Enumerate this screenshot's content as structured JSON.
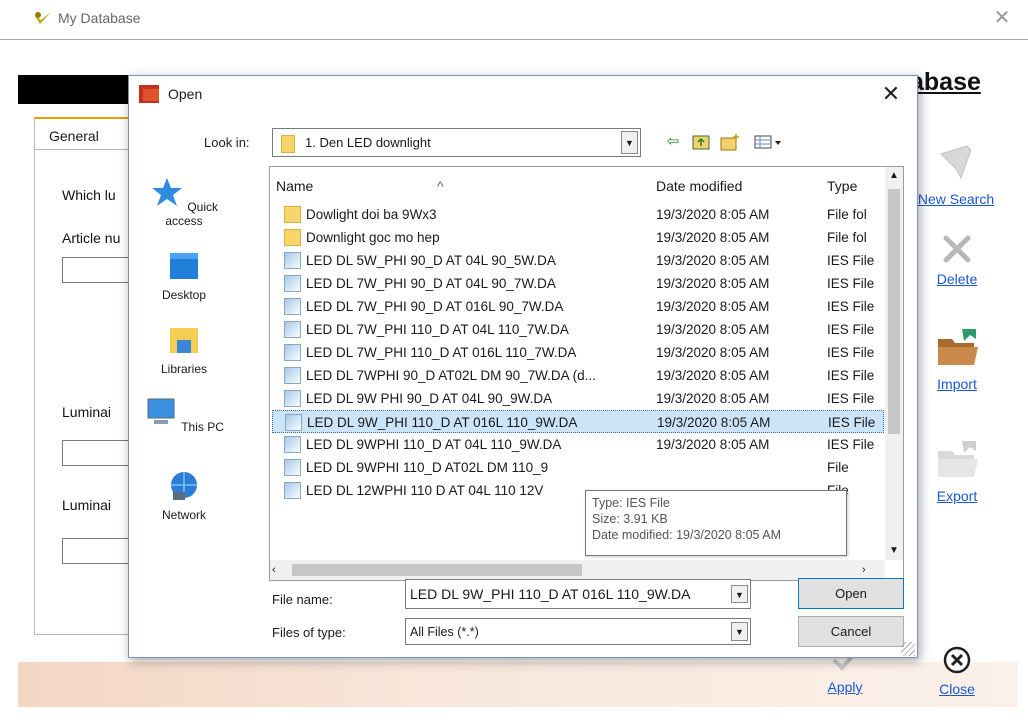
{
  "app": {
    "title": "My Database",
    "header_title": "abase",
    "general_tab": "General",
    "labels": {
      "which": "Which lu",
      "article": "Article nu",
      "luminai1": "Luminai",
      "luminai2": "Luminai"
    },
    "side_buttons": {
      "new_search": "New Search",
      "delete": "Delete",
      "import": "Import",
      "export": "Export",
      "apply": "Apply",
      "close": "Close"
    }
  },
  "dialog": {
    "title": "Open",
    "look_in_label": "Look in:",
    "look_in_value": "1. Den LED downlight",
    "places": [
      "Quick access",
      "Desktop",
      "Libraries",
      "This PC",
      "Network"
    ],
    "columns": {
      "name": "Name",
      "date": "Date modified",
      "type": "Type"
    },
    "files": [
      {
        "name": "Dowlight doi ba  9Wx3",
        "date": "19/3/2020 8:05 AM",
        "type": "File fol",
        "kind": "folder"
      },
      {
        "name": "Downlight goc mo hep",
        "date": "19/3/2020 8:05 AM",
        "type": "File fol",
        "kind": "folder"
      },
      {
        "name": "LED DL 5W_PHI 90_D AT 04L 90_5W.DA",
        "date": "19/3/2020 8:05 AM",
        "type": "IES File",
        "kind": "file"
      },
      {
        "name": "LED DL 7W_PHI 90_D AT 04L 90_7W.DA",
        "date": "19/3/2020 8:05 AM",
        "type": "IES File",
        "kind": "file"
      },
      {
        "name": "LED DL 7W_PHI 90_D AT 016L 90_7W.DA",
        "date": "19/3/2020 8:05 AM",
        "type": "IES File",
        "kind": "file"
      },
      {
        "name": "LED DL 7W_PHI 110_D AT 04L 110_7W.DA",
        "date": "19/3/2020 8:05 AM",
        "type": "IES File",
        "kind": "file"
      },
      {
        "name": "LED DL 7W_PHI 110_D AT 016L 110_7W.DA",
        "date": "19/3/2020 8:05 AM",
        "type": "IES File",
        "kind": "file"
      },
      {
        "name": "LED DL 7WPHI 90_D AT02L DM 90_7W.DA (d...",
        "date": "19/3/2020 8:05 AM",
        "type": "IES File",
        "kind": "file"
      },
      {
        "name": "LED DL 9W PHI 90_D AT 04L 90_9W.DA",
        "date": "19/3/2020 8:05 AM",
        "type": "IES File",
        "kind": "file"
      },
      {
        "name": "LED DL 9W_PHI 110_D AT 016L 110_9W.DA",
        "date": "19/3/2020 8:05 AM",
        "type": "IES File",
        "kind": "file",
        "selected": true
      },
      {
        "name": "LED DL 9WPHI 110_D AT 04L 110_9W.DA",
        "date": "19/3/2020 8:05 AM",
        "type": "IES File",
        "kind": "file"
      },
      {
        "name": "LED DL 9WPHI 110_D AT02L DM 110_9",
        "date": "",
        "type": "File",
        "kind": "file"
      },
      {
        "name": "LED DL 12WPHI 110  D AT 04L 110  12V",
        "date": "",
        "type": "File",
        "kind": "file"
      }
    ],
    "tooltip": {
      "type": "Type: IES File",
      "size": "Size: 3.91 KB",
      "date": "Date modified: 19/3/2020 8:05 AM"
    },
    "file_name_label": "File name:",
    "file_name_value": "LED DL 9W_PHI 110_D AT 016L 110_9W.DA",
    "files_of_type_label": "Files of type:",
    "files_of_type_value": "All Files (*.*)",
    "open_button": "Open",
    "cancel_button": "Cancel"
  }
}
